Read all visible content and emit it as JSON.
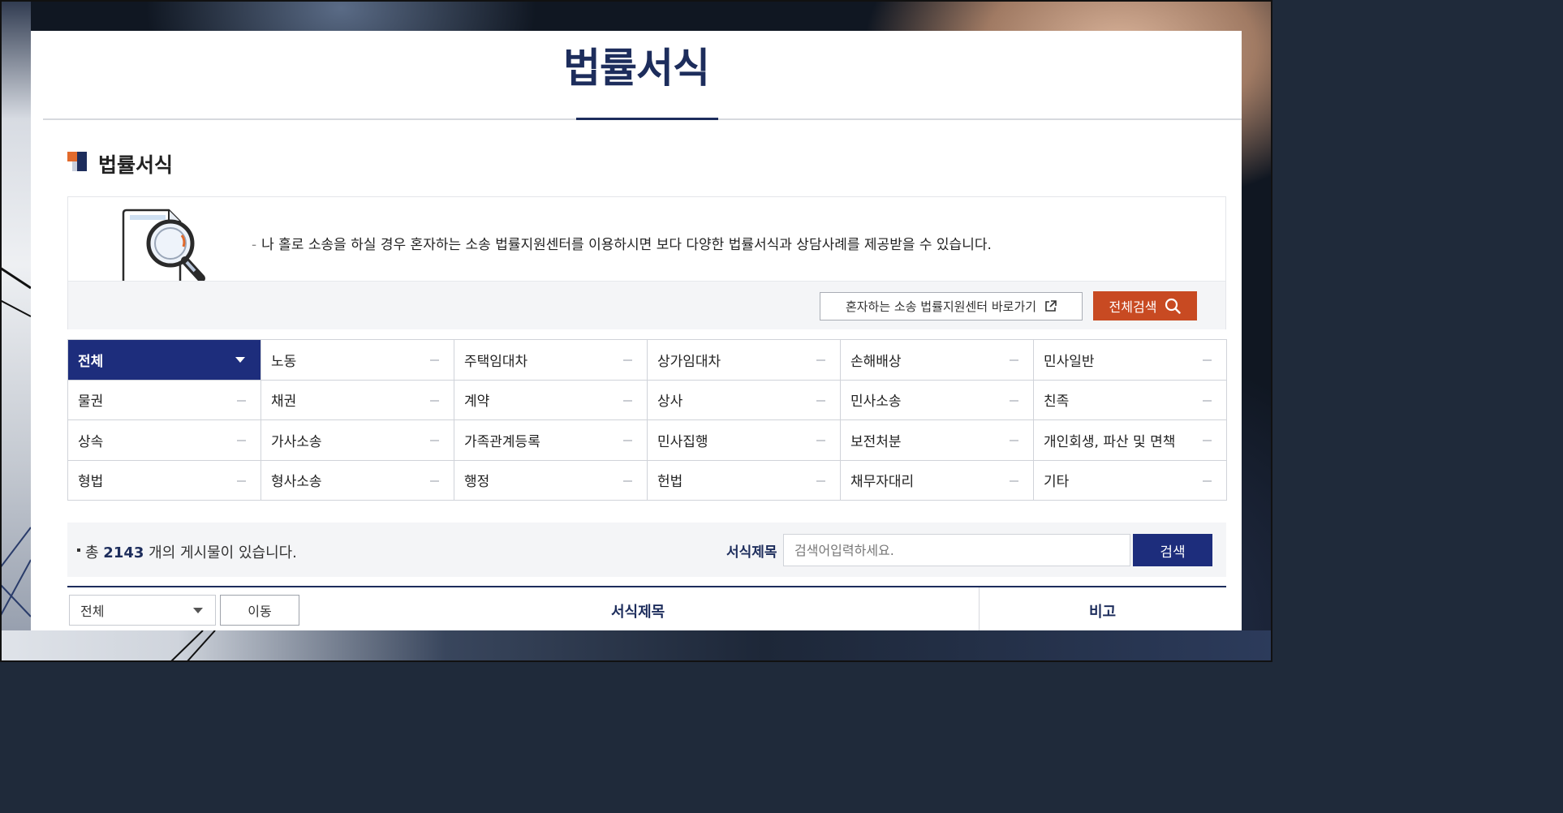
{
  "page": {
    "title": "법률서식"
  },
  "section": {
    "title": "법률서식"
  },
  "info": {
    "dash": "-",
    "text": "나 홀로 소송을 하실 경우 혼자하는 소송 법률지원센터를 이용하시면 보다 다양한 법률서식과 상담사례를 제공받을 수 있습니다.",
    "link_button": "혼자하는 소송 법률지원센터 바로가기",
    "all_search_button": "전체검색"
  },
  "categories": [
    "전체",
    "노동",
    "주택임대차",
    "상가임대차",
    "손해배상",
    "민사일반",
    "물권",
    "채권",
    "계약",
    "상사",
    "민사소송",
    "친족",
    "상속",
    "가사소송",
    "가족관계등록",
    "민사집행",
    "보전처분",
    "개인회생, 파산 및 면책",
    "형법",
    "형사소송",
    "행정",
    "헌법",
    "채무자대리",
    "기타"
  ],
  "active_category": "전체",
  "search": {
    "total_prefix": "총",
    "total_count": "2143",
    "total_suffix": "개의 게시물이 있습니다.",
    "label": "서식제목",
    "placeholder": "검색어입력하세요.",
    "value": "",
    "button": "검색"
  },
  "table": {
    "select_value": "전체",
    "move_button": "이동",
    "col_title": "서식제목",
    "col_note": "비고"
  },
  "colors": {
    "navy": "#1d2d5c",
    "active_cell": "#1d2d7c",
    "orange_button": "#c84a22",
    "accent_orange": "#e26a2c"
  },
  "icons": {
    "external_link": "external-link-icon",
    "search": "search-icon",
    "dropdown": "chevron-down-icon"
  }
}
